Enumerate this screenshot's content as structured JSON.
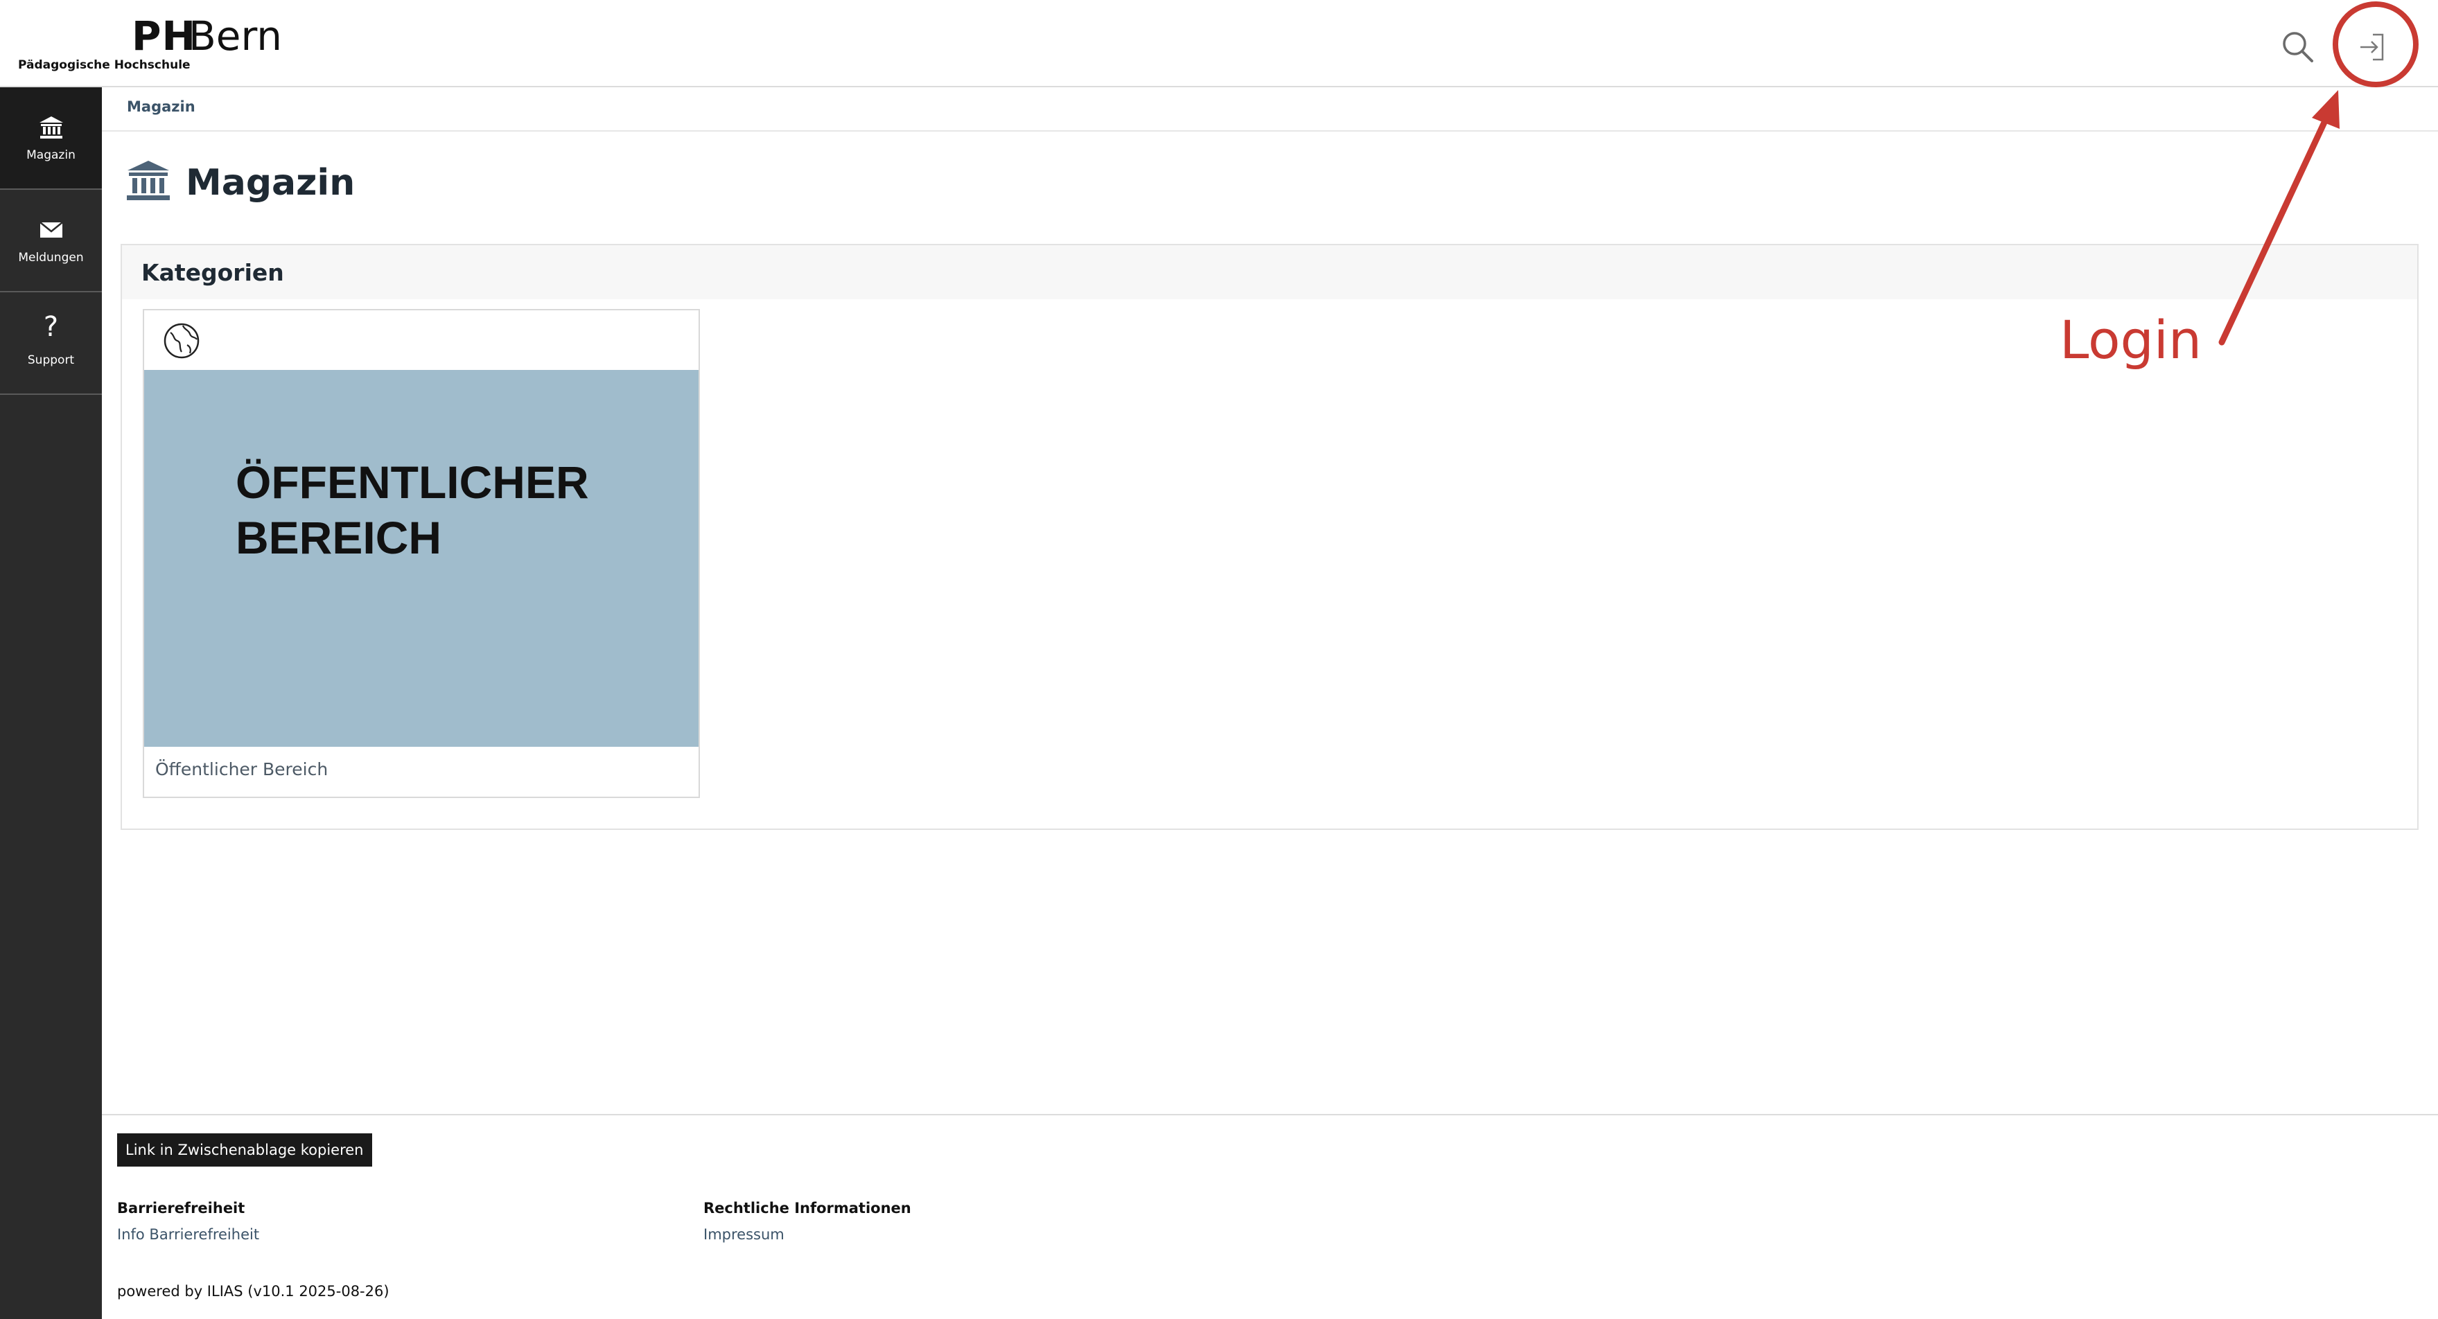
{
  "header": {
    "logo_ph": "PH",
    "logo_bern": "Bern",
    "logo_subtitle": "Pädagogische Hochschule",
    "search_icon": "search-icon",
    "login_icon": "login-icon"
  },
  "mainbar": {
    "items": [
      {
        "label": "Magazin",
        "icon": "building-icon"
      },
      {
        "label": "Meldungen",
        "icon": "envelope-icon"
      },
      {
        "label": "Support",
        "icon": "question-icon",
        "glyph": "?"
      }
    ]
  },
  "breadcrumb": {
    "items": [
      "Magazin"
    ]
  },
  "page": {
    "title": "Magazin",
    "icon": "building-icon"
  },
  "panel": {
    "title": "Kategorien",
    "cards": [
      {
        "icon": "globe-icon",
        "image_text_line1": "ÖFFENTLICHER",
        "image_text_line2": "BEREICH",
        "caption": "Öffentlicher Bereich"
      }
    ]
  },
  "annotation": {
    "label": "Login",
    "color": "#c93a32"
  },
  "footer": {
    "copy_link_label": "Link in Zwischenablage kopieren",
    "columns": [
      {
        "title": "Barrierefreiheit",
        "links": [
          "Info Barrierefreiheit"
        ]
      },
      {
        "title": "Rechtliche Informationen",
        "links": [
          "Impressum"
        ]
      }
    ],
    "powered_by": "powered by ILIAS (v10.1 2025-08-26)"
  },
  "colors": {
    "mainbar_bg": "#2b2b2b",
    "card_image_bg": "#a0bccc",
    "link": "#3b5368",
    "annotation": "#c93a32"
  }
}
